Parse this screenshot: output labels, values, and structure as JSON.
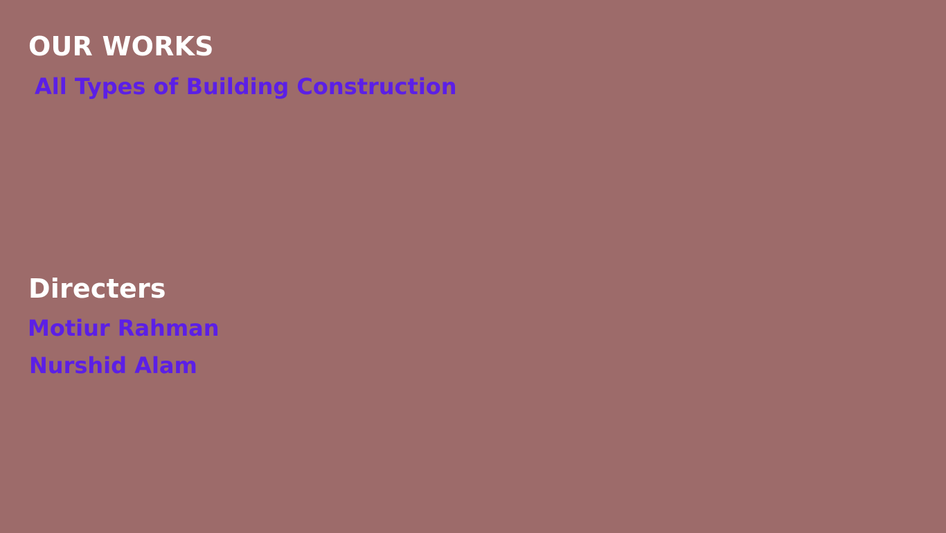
{
  "works": {
    "title": "OUR WORKS",
    "items": [
      "All Types of Building Construction"
    ]
  },
  "directors": {
    "title": "Directers",
    "names": [
      "Motiur Rahman",
      "Nurshid Alam"
    ]
  },
  "colors": {
    "background": "#9d6b6a",
    "heading": "#ffffff",
    "accent": "#5b1fe6"
  }
}
